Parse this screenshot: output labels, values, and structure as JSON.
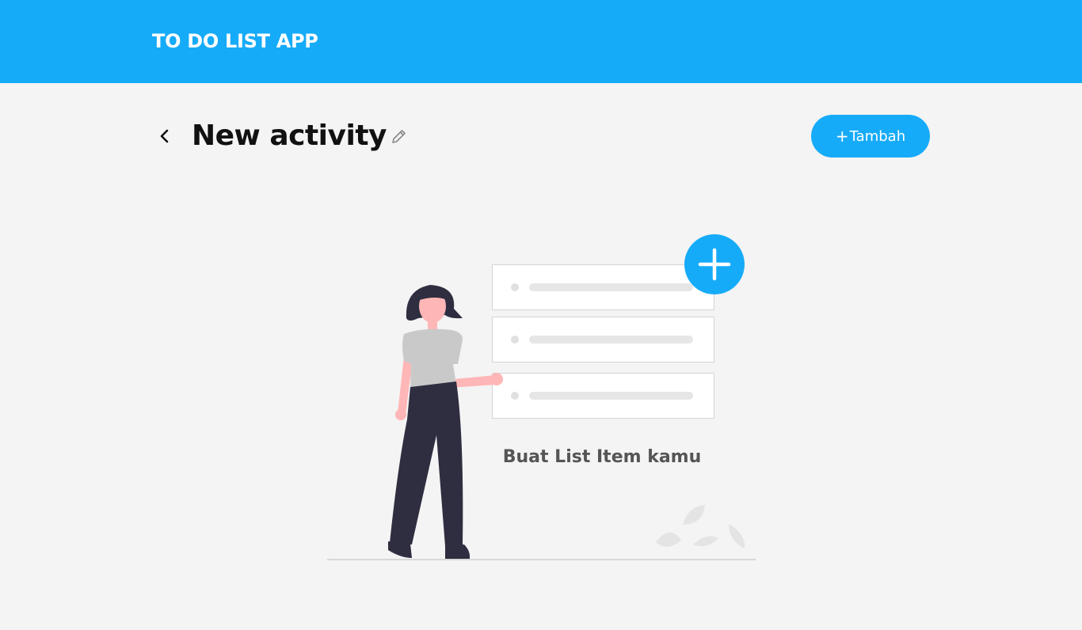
{
  "header": {
    "app_title": "TO DO LIST APP",
    "background_color": "#16abf8"
  },
  "activity": {
    "title": "New activity",
    "back_icon": "chevron-left-icon",
    "edit_icon": "pencil-icon"
  },
  "toolbar": {
    "add_label": "Tambah",
    "add_prefix": "+",
    "add_icon": "plus-icon",
    "accent_color": "#16abf8"
  },
  "empty_state": {
    "message": "Buat List Item kamu",
    "illustration": "woman-with-todo-list-illustration"
  }
}
